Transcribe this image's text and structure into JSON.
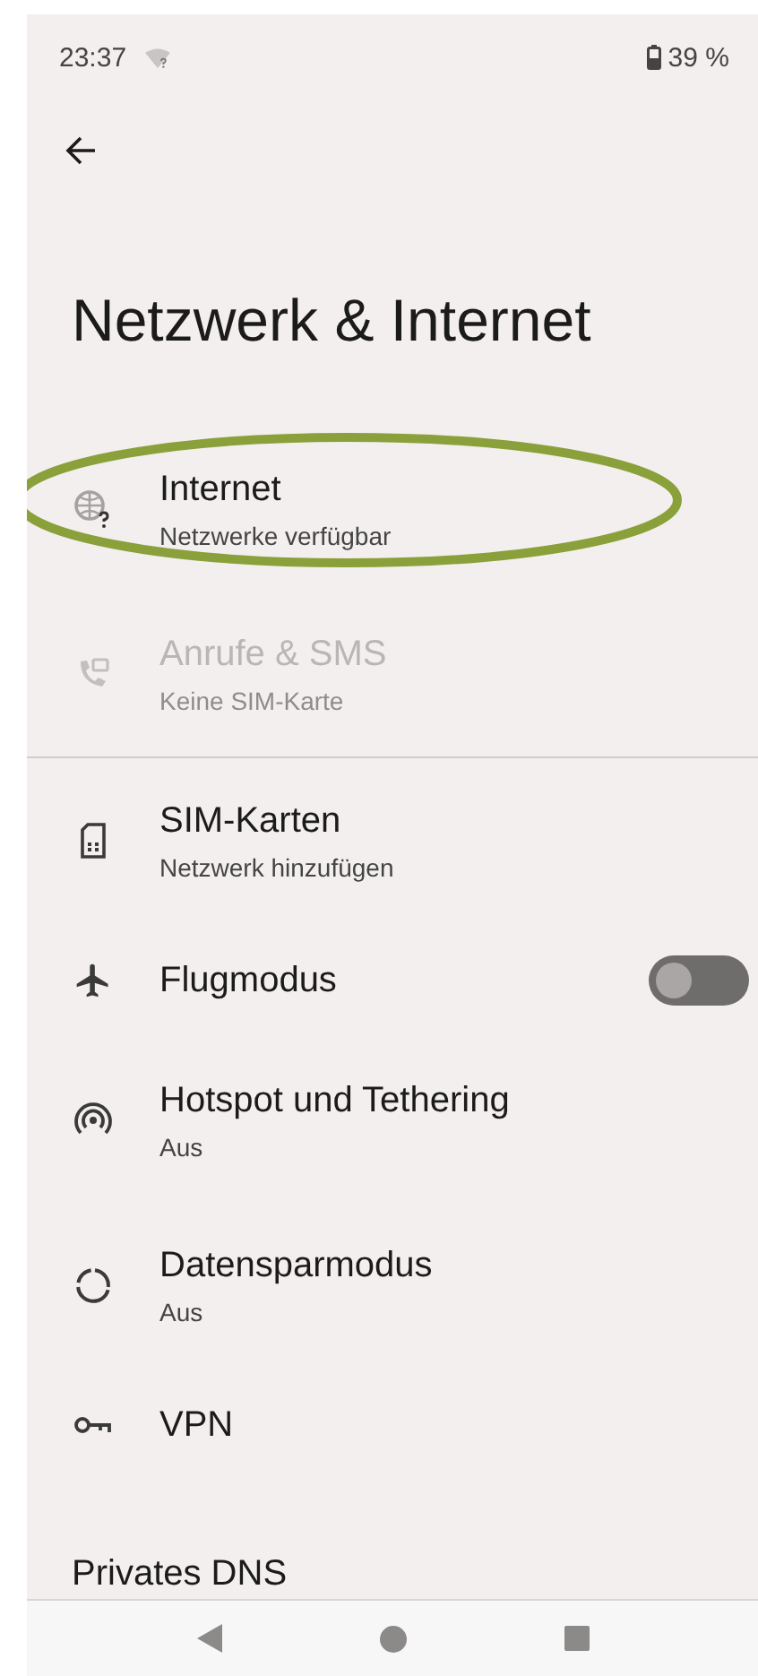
{
  "status_bar": {
    "time": "23:37",
    "battery": "39 %"
  },
  "page": {
    "title": "Netzwerk & Internet"
  },
  "items": [
    {
      "kind": "link",
      "title": "Internet",
      "subtitle": "Netzwerke verfügbar",
      "disabled": false,
      "annotated": true
    },
    {
      "kind": "link",
      "title": "Anrufe & SMS",
      "subtitle": "Keine SIM-Karte",
      "disabled": true,
      "annotated": false
    },
    {
      "kind": "divider"
    },
    {
      "kind": "link",
      "title": "SIM-Karten",
      "subtitle": "Netzwerk hinzufügen",
      "disabled": false,
      "annotated": false
    },
    {
      "kind": "toggle",
      "title": "Flugmodus",
      "on": false,
      "disabled": false,
      "annotated": false
    },
    {
      "kind": "link",
      "title": "Hotspot und Tethering",
      "subtitle": "Aus",
      "disabled": false,
      "annotated": false
    },
    {
      "kind": "link",
      "title": "Datensparmodus",
      "subtitle": "Aus",
      "disabled": false,
      "annotated": false
    },
    {
      "kind": "link",
      "title": "VPN",
      "disabled": false,
      "annotated": false
    },
    {
      "kind": "plain",
      "title": "Privates DNS",
      "disabled": false
    }
  ]
}
